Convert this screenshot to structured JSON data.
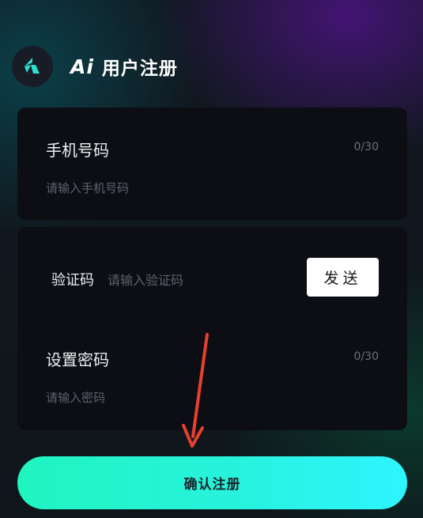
{
  "header": {
    "ai_text": "Ai",
    "title": "用户注册",
    "logo_icon": "app-logo-icon"
  },
  "phone": {
    "label": "手机号码",
    "counter": "0/30",
    "placeholder": "请输入手机号码"
  },
  "code": {
    "label": "验证码",
    "placeholder": "请输入验证码",
    "send_label": "发送"
  },
  "password": {
    "label": "设置密码",
    "counter": "0/30",
    "placeholder": "请输入密码"
  },
  "confirm": {
    "label": "确认注册"
  },
  "annotation": {
    "icon": "red-arrow-icon",
    "color": "#e8402e"
  },
  "colors": {
    "accent_start": "#20f4c0",
    "accent_end": "#2ef4ff",
    "card": "#0c0e13"
  }
}
